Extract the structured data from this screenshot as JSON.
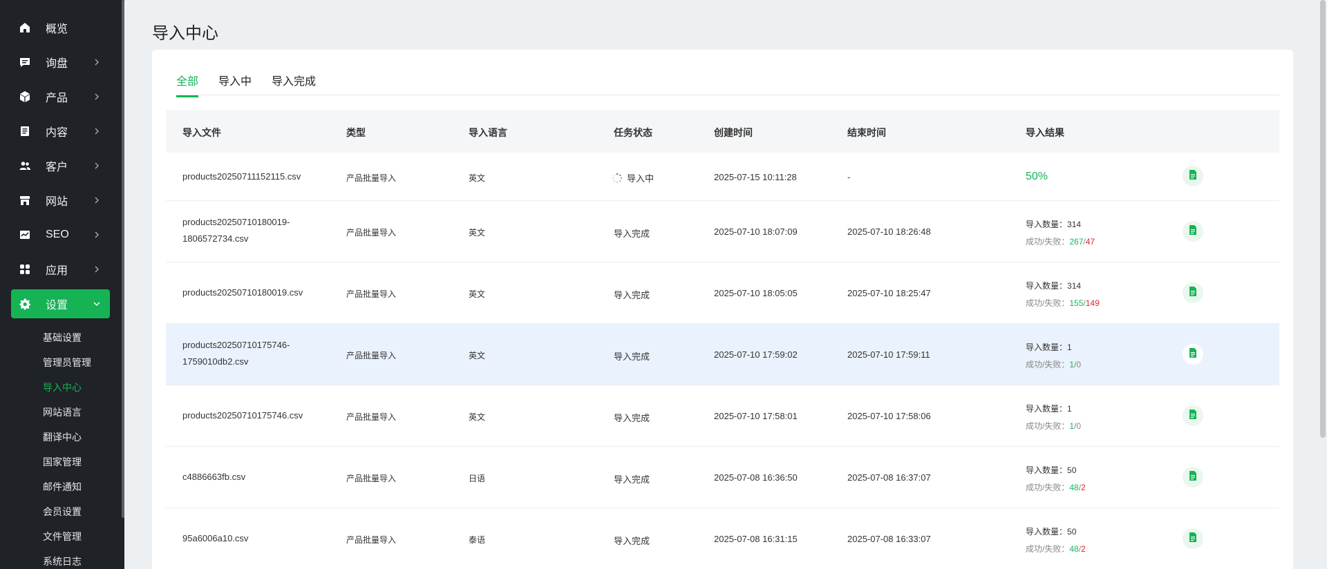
{
  "sidebar": {
    "items": [
      {
        "label": "概览",
        "icon": "home-icon"
      },
      {
        "label": "询盘",
        "icon": "message-icon"
      },
      {
        "label": "产品",
        "icon": "box-icon"
      },
      {
        "label": "内容",
        "icon": "document-icon"
      },
      {
        "label": "客户",
        "icon": "users-icon"
      },
      {
        "label": "网站",
        "icon": "store-icon"
      },
      {
        "label": "SEO",
        "icon": "chart-icon"
      },
      {
        "label": "应用",
        "icon": "apps-icon"
      },
      {
        "label": "设置",
        "icon": "gear-icon"
      }
    ],
    "sub_items": [
      "基础设置",
      "管理员管理",
      "导入中心",
      "网站语言",
      "翻译中心",
      "国家管理",
      "邮件通知",
      "会员设置",
      "文件管理",
      "系统日志"
    ]
  },
  "page": {
    "title": "导入中心"
  },
  "tabs": [
    "全部",
    "导入中",
    "导入完成"
  ],
  "table": {
    "headers": [
      "导入文件",
      "类型",
      "导入语言",
      "任务状态",
      "创建时间",
      "结束时间",
      "导入结果"
    ],
    "count_label": "导入数量：",
    "ratio_label": "成功/失败：",
    "rows": [
      {
        "file": "products20250711152115.csv",
        "type": "产品批量导入",
        "lang": "英文",
        "status": "导入中",
        "created": "2025-07-15 10:11:28",
        "ended": "-",
        "progress": "50%",
        "count": "",
        "success": "",
        "fail": ""
      },
      {
        "file": "products20250710180019-1806572734.csv",
        "type": "产品批量导入",
        "lang": "英文",
        "status": "导入完成",
        "created": "2025-07-10 18:07:09",
        "ended": "2025-07-10 18:26:48",
        "progress": "",
        "count": "314",
        "success": "267",
        "fail": "47"
      },
      {
        "file": "products20250710180019.csv",
        "type": "产品批量导入",
        "lang": "英文",
        "status": "导入完成",
        "created": "2025-07-10 18:05:05",
        "ended": "2025-07-10 18:25:47",
        "progress": "",
        "count": "314",
        "success": "155",
        "fail": "149"
      },
      {
        "file": "products20250710175746-1759010db2.csv",
        "type": "产品批量导入",
        "lang": "英文",
        "status": "导入完成",
        "created": "2025-07-10 17:59:02",
        "ended": "2025-07-10 17:59:11",
        "progress": "",
        "count": "1",
        "success": "1",
        "fail": "0"
      },
      {
        "file": "products20250710175746.csv",
        "type": "产品批量导入",
        "lang": "英文",
        "status": "导入完成",
        "created": "2025-07-10 17:58:01",
        "ended": "2025-07-10 17:58:06",
        "progress": "",
        "count": "1",
        "success": "1",
        "fail": "0"
      },
      {
        "file": "c4886663fb.csv",
        "type": "产品批量导入",
        "lang": "日语",
        "status": "导入完成",
        "created": "2025-07-08 16:36:50",
        "ended": "2025-07-08 16:37:07",
        "progress": "",
        "count": "50",
        "success": "48",
        "fail": "2"
      },
      {
        "file": "95a6006a10.csv",
        "type": "产品批量导入",
        "lang": "泰语",
        "status": "导入完成",
        "created": "2025-07-08 16:31:15",
        "ended": "2025-07-08 16:33:07",
        "progress": "",
        "count": "50",
        "success": "48",
        "fail": "2"
      }
    ]
  },
  "colors": {
    "accent": "#16b355",
    "fail": "#e02424",
    "sidebar_bg": "#1f2226",
    "row_hover": "#eaf2fd"
  }
}
